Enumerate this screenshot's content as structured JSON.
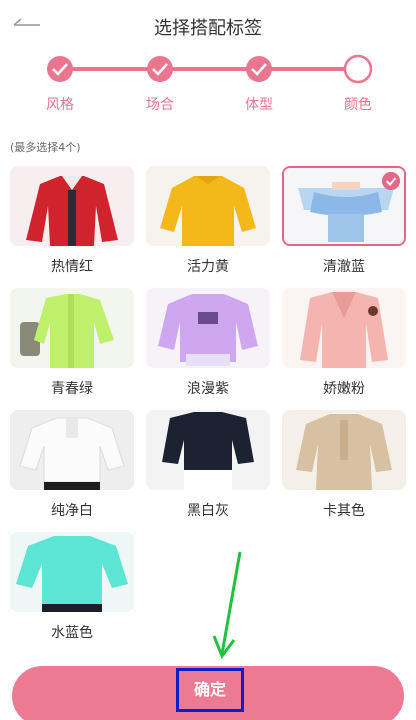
{
  "header": {
    "title": "选择搭配标签",
    "back_icon": "back-arrow-icon"
  },
  "steps": [
    {
      "label": "风格",
      "done": true
    },
    {
      "label": "场合",
      "done": true
    },
    {
      "label": "体型",
      "done": true
    },
    {
      "label": "颜色",
      "done": false
    }
  ],
  "hint": "(最多选择4个)",
  "colors": {
    "accent": "#e56786",
    "button": "#ec7a93",
    "highlight_border": "#0b1ec8",
    "arrow": "#1fc23d"
  },
  "items": [
    {
      "label": "热情红",
      "selected": false
    },
    {
      "label": "活力黄",
      "selected": false
    },
    {
      "label": "清澈蓝",
      "selected": true
    },
    {
      "label": "青春绿",
      "selected": false
    },
    {
      "label": "浪漫紫",
      "selected": false
    },
    {
      "label": "娇嫩粉",
      "selected": false
    },
    {
      "label": "纯净白",
      "selected": false
    },
    {
      "label": "黑白灰",
      "selected": false
    },
    {
      "label": "卡其色",
      "selected": false
    },
    {
      "label": "水蓝色",
      "selected": false
    }
  ],
  "confirm": {
    "label": "确定"
  }
}
